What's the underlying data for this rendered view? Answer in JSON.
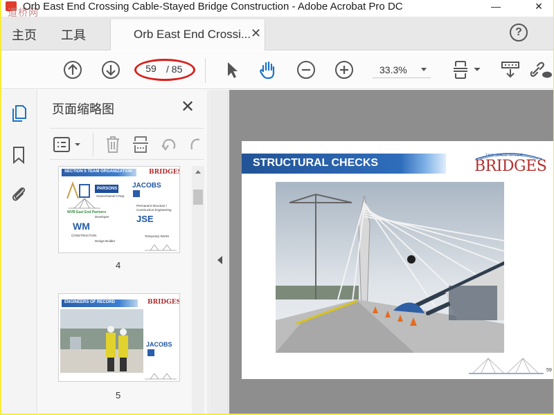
{
  "window": {
    "title": "Orb East End Crossing Cable-Stayed Bridge Construction - Adobe Acrobat Pro DC",
    "watermark": "道桥网",
    "controls": {
      "minimize": "—",
      "close": "✕"
    }
  },
  "tabs": {
    "home": "主页",
    "tools": "工具",
    "document": "Orb East End Crossi...",
    "close_symbol": "✕",
    "help_symbol": "?"
  },
  "toolbar": {
    "page_current": "59",
    "page_total": "/ 85",
    "zoom": "33.3%"
  },
  "thumbnail_panel": {
    "title": "页面缩略图",
    "close_symbol": "✕",
    "thumbnails": [
      {
        "page_number": "4",
        "heading": "SECTION 5 TEAM ORGANIZATION",
        "logo": "BRIDGES",
        "labels": [
          "PARSONS",
          "JACOBS",
          "WVB East End Partners",
          "WM",
          "CONSTRUCTION",
          "JSE"
        ],
        "captions": [
          "Owner/Owner's Rep",
          "Developer",
          "Permanent Structure / Construction Engineering",
          "Design Builder",
          "Temporary Works"
        ]
      },
      {
        "page_number": "5",
        "heading": "ENGINEERS OF RECORD",
        "logo": "BRIDGES",
        "labels": [
          "JACOBS"
        ]
      }
    ]
  },
  "slide": {
    "title": "STRUCTURAL CHECKS",
    "logo": "BRIDGES",
    "logo_sub": "THE OHIO RIVER",
    "page_number": "59"
  },
  "colors": {
    "outer_border": "#f7ec3a",
    "slide_band": "#225397",
    "logo_red": "#b2302f",
    "annotation_red": "#d8201c",
    "doc_background": "#8e8e8e"
  },
  "icons": {
    "toolbar": [
      "prev-page-icon",
      "next-page-icon",
      "select-arrow-icon",
      "hand-icon",
      "zoom-out-icon",
      "zoom-in-icon",
      "page-fit-icon",
      "scroll-mode-icon",
      "share-link-icon"
    ],
    "rail": [
      "page-thumbnails-icon",
      "bookmark-icon",
      "attachment-icon"
    ],
    "thumb_tools": [
      "thumbnail-options-icon",
      "delete-icon",
      "extract-icon",
      "undo-icon",
      "redo-icon"
    ]
  }
}
